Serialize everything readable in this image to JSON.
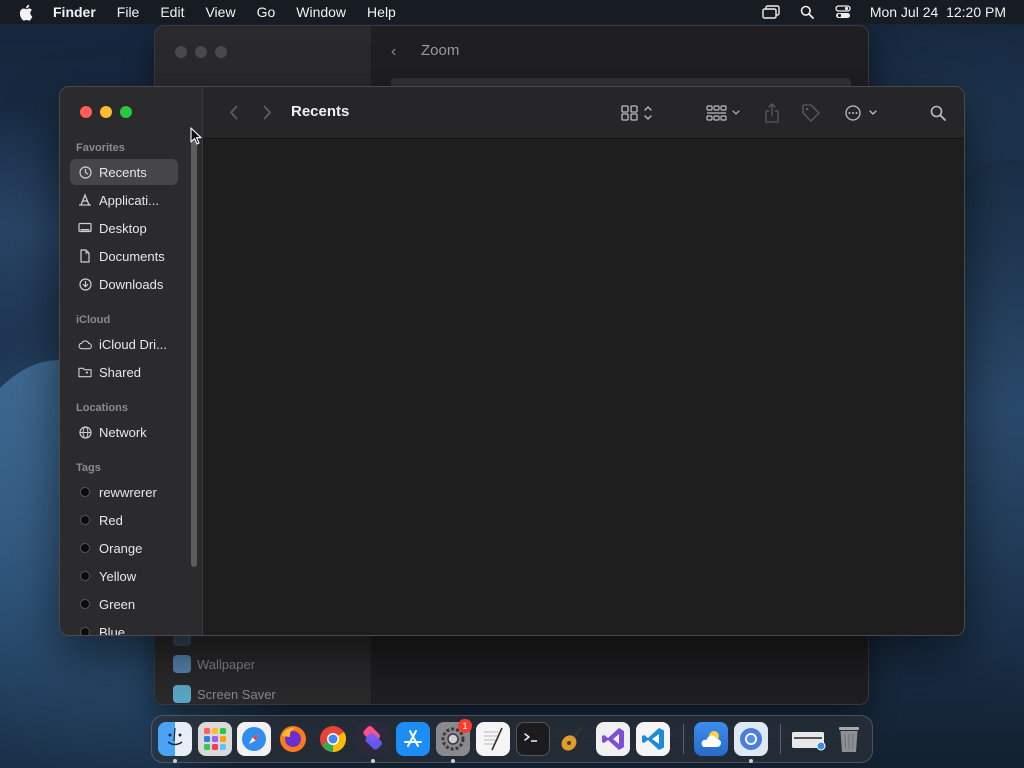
{
  "menubar": {
    "app_name": "Finder",
    "items": [
      "File",
      "Edit",
      "View",
      "Go",
      "Window",
      "Help"
    ],
    "clock": "Mon Jul 24  12:20 PM"
  },
  "background_window": {
    "title": "Zoom",
    "items": [
      {
        "label": "Wallpaper",
        "icon": "wallpaper-icon"
      },
      {
        "label": "Screen Saver",
        "icon": "screen-saver-icon"
      }
    ]
  },
  "finder": {
    "title": "Recents",
    "sidebar": {
      "favorites_label": "Favorites",
      "favorites": [
        {
          "label": "Recents",
          "icon": "clock-icon",
          "selected": true
        },
        {
          "label": "Applicati...",
          "icon": "applications-icon"
        },
        {
          "label": "Desktop",
          "icon": "desktop-icon"
        },
        {
          "label": "Documents",
          "icon": "document-icon"
        },
        {
          "label": "Downloads",
          "icon": "downloads-icon"
        }
      ],
      "icloud_label": "iCloud",
      "icloud": [
        {
          "label": "iCloud Dri...",
          "icon": "cloud-icon"
        },
        {
          "label": "Shared",
          "icon": "shared-folder-icon"
        }
      ],
      "locations_label": "Locations",
      "locations": [
        {
          "label": "Network",
          "icon": "globe-icon"
        }
      ],
      "tags_label": "Tags",
      "tags": [
        {
          "label": "rewwrerer",
          "color": "#0b0b0b"
        },
        {
          "label": "Red",
          "color": "#0b0b0b"
        },
        {
          "label": "Orange",
          "color": "#0b0b0b"
        },
        {
          "label": "Yellow",
          "color": "#0b0b0b"
        },
        {
          "label": "Green",
          "color": "#0b0b0b"
        },
        {
          "label": "Blue",
          "color": "#0b0b0b"
        }
      ]
    },
    "toolbar": {
      "icons": [
        "back-icon",
        "forward-icon",
        "view-grid-icon",
        "group-icon",
        "share-icon",
        "tag-icon",
        "more-icon",
        "search-icon"
      ]
    }
  },
  "dock": {
    "apps": [
      {
        "name": "finder-icon",
        "color": "#3a8ee6",
        "running": true
      },
      {
        "name": "launchpad-icon",
        "color": "#d9d9d9",
        "running": false
      },
      {
        "name": "safari-icon",
        "color": "#2f7fe0",
        "running": false
      },
      {
        "name": "firefox-icon",
        "color": "#ff7a1a",
        "running": false
      },
      {
        "name": "chrome-icon",
        "color": "#e9e9e9",
        "running": false
      },
      {
        "name": "shortcuts-icon",
        "color": "#7b4fe0",
        "running": true
      },
      {
        "name": "app-store-icon",
        "color": "#1c8df5",
        "running": false
      },
      {
        "name": "system-settings-icon",
        "color": "#8a8a8e",
        "running": true,
        "badge": "1"
      },
      {
        "name": "textedit-icon",
        "color": "#f2f2f2",
        "running": false
      },
      {
        "name": "terminal-icon",
        "color": "#1a1a1a",
        "running": false
      },
      {
        "name": "garageband-icon",
        "color": "#4a3a2a",
        "running": false
      },
      {
        "name": "visual-studio-icon",
        "color": "#6a3cc4",
        "running": false
      },
      {
        "name": "vscode-icon",
        "color": "#f0f0f0",
        "running": false
      },
      {
        "name": "weather-icon",
        "color": "#3a8ef0",
        "running": false
      },
      {
        "name": "chromium-icon",
        "color": "#d4e2f5",
        "running": true
      },
      {
        "name": "downloads-stack-icon",
        "color": "#2a2a2c",
        "running": false
      },
      {
        "name": "trash-icon",
        "color": "#9a9a9e",
        "running": false
      }
    ]
  }
}
